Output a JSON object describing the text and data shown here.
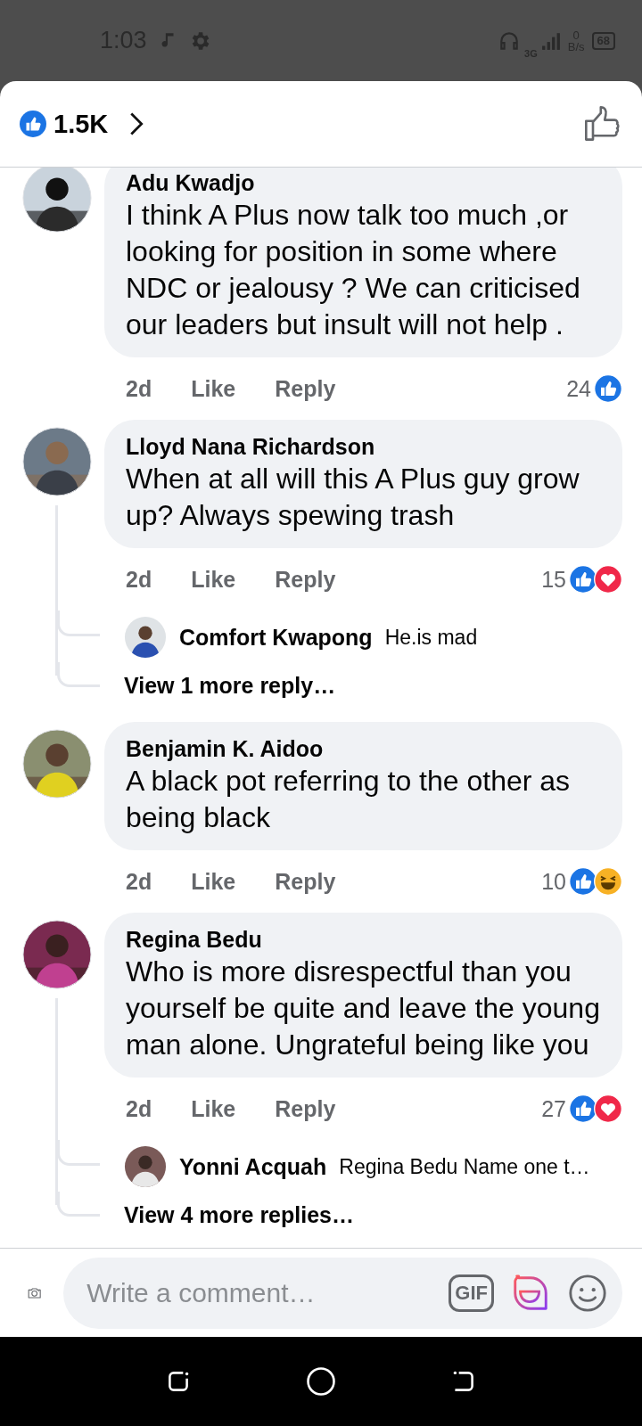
{
  "status_bar": {
    "time": "1:03",
    "network": "3G",
    "speed_value": "0",
    "speed_unit": "B/s",
    "battery": "68"
  },
  "header": {
    "reaction_count": "1.5K"
  },
  "comments": [
    {
      "author": "Adu Kwadjo",
      "text": "I  think A Plus now talk too much ,or looking for position in some where NDC or jealousy ? We can criticised our leaders but insult will  not help .",
      "time": "2d",
      "like": "Like",
      "reply": "Reply",
      "count": "24",
      "reactions": [
        {
          "kind": "like"
        }
      ]
    },
    {
      "author": "Lloyd Nana Richardson",
      "text": "When at all will this A Plus guy grow up? Always spewing trash",
      "time": "2d",
      "like": "Like",
      "reply": "Reply",
      "count": "15",
      "reactions": [
        {
          "kind": "like"
        },
        {
          "kind": "love"
        }
      ],
      "replies": [
        {
          "author": "Comfort Kwapong",
          "text": "He.is mad"
        }
      ],
      "more": "View 1 more reply…"
    },
    {
      "author": "Benjamin K. Aidoo",
      "text": "A black pot referring to the other as being black",
      "time": "2d",
      "like": "Like",
      "reply": "Reply",
      "count": "10",
      "reactions": [
        {
          "kind": "like"
        },
        {
          "kind": "haha"
        }
      ]
    },
    {
      "author": "Regina Bedu",
      "text": "Who is more disrespectful than you yourself be quite and leave the young man alone. Ungrateful being like you",
      "time": "2d",
      "like": "Like",
      "reply": "Reply",
      "count": "27",
      "reactions": [
        {
          "kind": "like"
        },
        {
          "kind": "love"
        }
      ],
      "replies": [
        {
          "author": "Yonni Acquah",
          "text": "Regina Bedu Name one t…"
        }
      ],
      "more": "View 4 more replies…"
    }
  ],
  "composer": {
    "placeholder": "Write a comment…",
    "gif": "GIF"
  }
}
